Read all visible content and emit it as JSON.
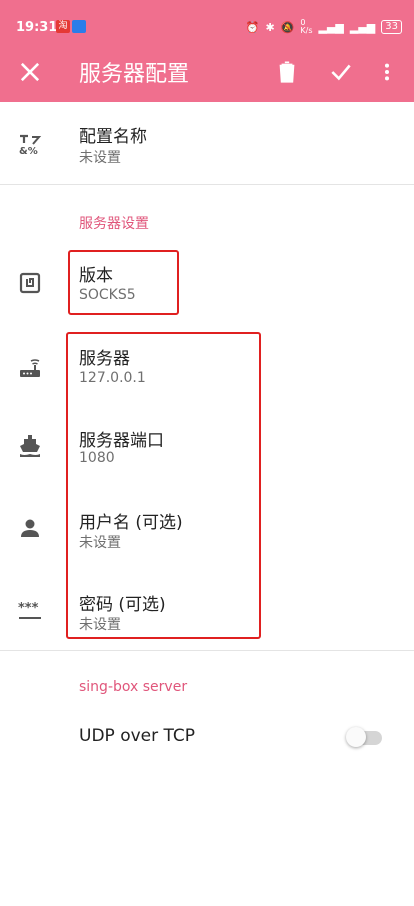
{
  "colors": {
    "toolbar": "#f06f8e",
    "section_header": "#e0567b",
    "highlight_box": "#e02020"
  },
  "status_bar": {
    "time": "19:31",
    "app_icon_1": "淘",
    "net_speed": "0\nK/s",
    "battery": "33"
  },
  "toolbar": {
    "title": "服务器配置",
    "close_icon": "close-icon",
    "delete_icon": "trash-icon",
    "save_icon": "check-icon",
    "more_icon": "more-vert-icon"
  },
  "items": [
    {
      "id": "profile_name",
      "icon": "text-format-icon",
      "title": "配置名称",
      "summary": "未设置"
    },
    {
      "id": "version",
      "icon": "nfc-icon",
      "title": "版本",
      "summary": "SOCKS5"
    },
    {
      "id": "server",
      "icon": "router-icon",
      "title": "服务器",
      "summary": "127.0.0.1"
    },
    {
      "id": "port",
      "icon": "ship-icon",
      "title": "服务器端口",
      "summary": "1080"
    },
    {
      "id": "username",
      "icon": "person-icon",
      "title": "用户名 (可选)",
      "summary": "未设置"
    },
    {
      "id": "password",
      "icon": "password-icon",
      "title": "密码 (可选)",
      "summary": "未设置"
    }
  ],
  "sections": {
    "server_settings": "服务器设置",
    "singbox": "sing-box server"
  },
  "udp_over_tcp": {
    "title": "UDP over TCP",
    "enabled": false
  }
}
